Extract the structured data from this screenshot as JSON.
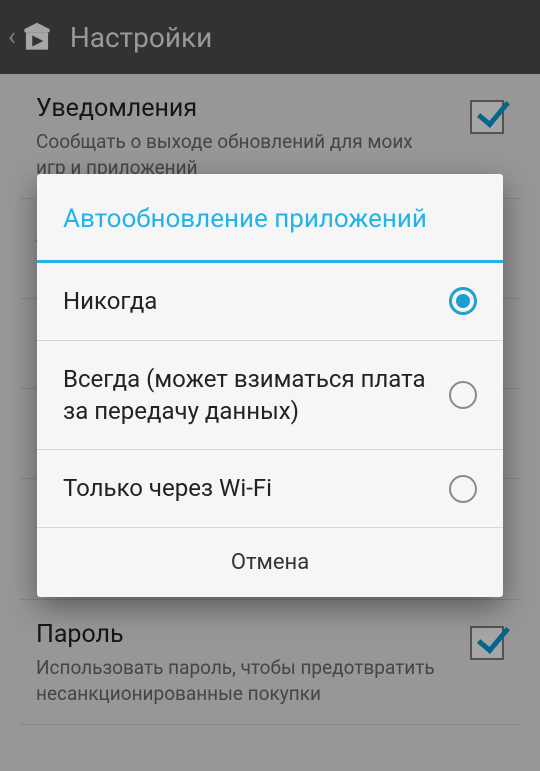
{
  "header": {
    "title": "Настройки"
  },
  "settings": {
    "notifications": {
      "label": "Уведомления",
      "summary": "Сообщать о выходе обновлений для моих игр и приложений",
      "checked": true
    },
    "autoupdate": {
      "label": "Автообновление приложений",
      "summary": "Никогда"
    },
    "password": {
      "label": "Пароль",
      "summary": "Использовать пароль, чтобы предотвратить несанкционированные покупки",
      "checked": true
    }
  },
  "dialog": {
    "title": "Автообновление приложений",
    "options": [
      {
        "label": "Никогда",
        "selected": true
      },
      {
        "label": "Всегда (может взиматься плата за передачу данных)",
        "selected": false
      },
      {
        "label": "Только через Wi-Fi",
        "selected": false
      }
    ],
    "cancel": "Отмена"
  }
}
